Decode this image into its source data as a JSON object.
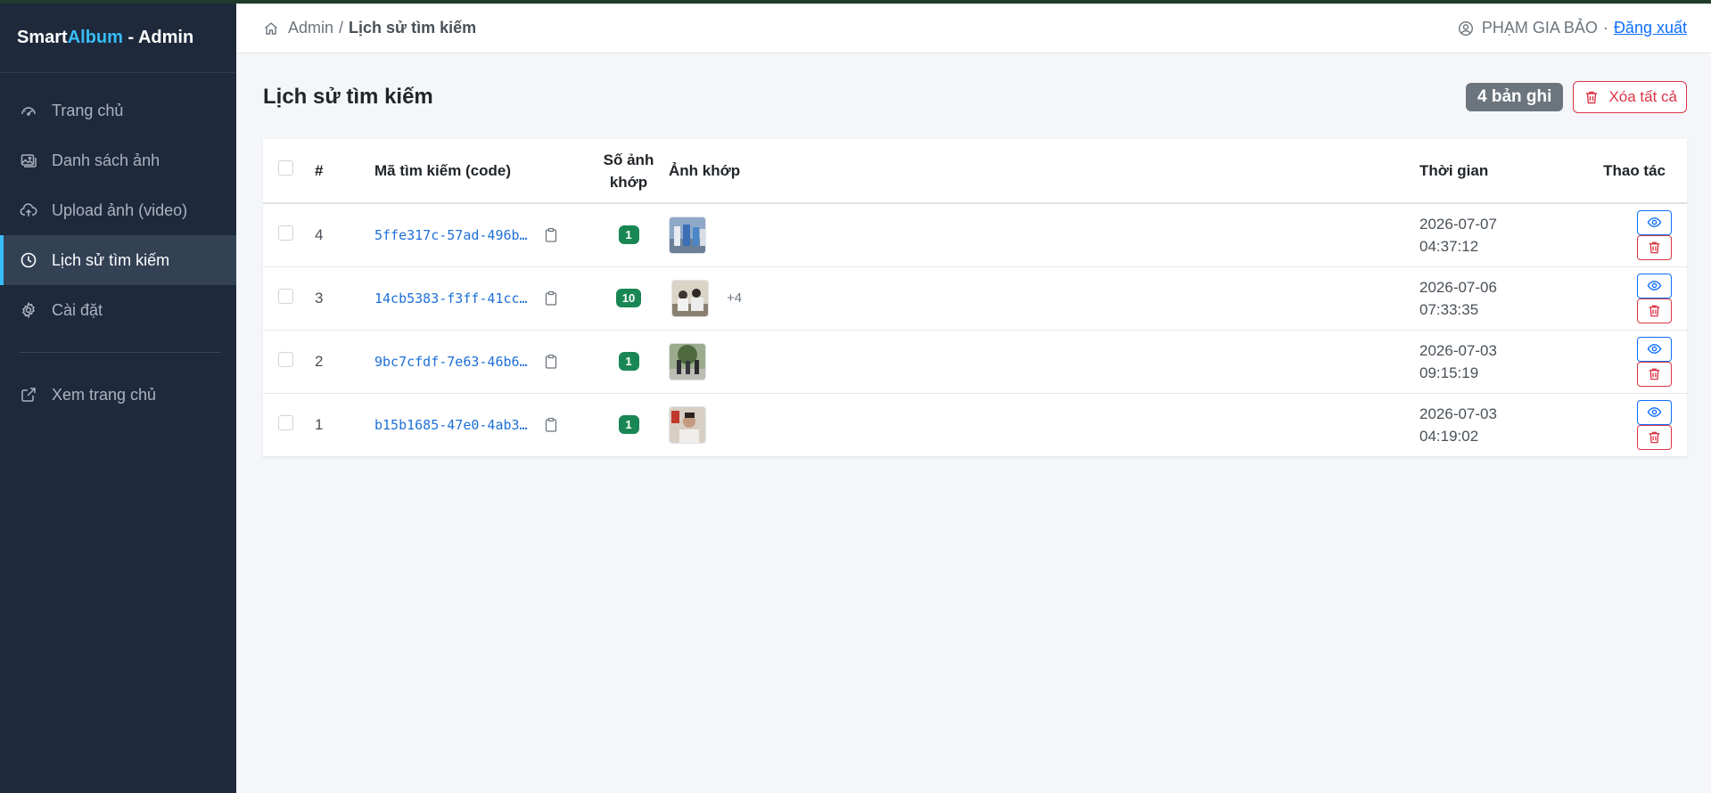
{
  "brand": {
    "part1": "Smart",
    "part2": "Album",
    "part3": " - Admin"
  },
  "colors": {
    "sidebar": "#1e293b",
    "accent": "#38bdf8",
    "primary": "#0d6efd",
    "danger": "#dc3545",
    "success": "#198754"
  },
  "sidebar": {
    "items": [
      {
        "label": "Trang chủ",
        "icon": "dashboard-icon"
      },
      {
        "label": "Danh sách ảnh",
        "icon": "images-icon"
      },
      {
        "label": "Upload ảnh (video)",
        "icon": "cloud-upload-icon"
      },
      {
        "label": "Lịch sử tìm kiếm",
        "icon": "clock-icon",
        "active": true
      },
      {
        "label": "Cài đặt",
        "icon": "gear-icon"
      }
    ],
    "external": {
      "label": "Xem trang chủ",
      "icon": "external-link-icon"
    }
  },
  "breadcrumb": {
    "root": "Admin",
    "sep": "/",
    "current": "Lịch sử tìm kiếm"
  },
  "user": {
    "name": "PHẠM GIA BẢO",
    "dot": "·",
    "logout": "Đăng xuất"
  },
  "page": {
    "title": "Lịch sử tìm kiếm",
    "count_badge": "4 bản ghi",
    "clear_label": "Xóa tất cả"
  },
  "table": {
    "headers": {
      "num": "#",
      "code": "Mã tìm kiếm (code)",
      "count_line1": "Số ảnh",
      "count_line2": "khớp",
      "images": "Ảnh khớp",
      "time": "Thời gian",
      "actions": "Thao tác"
    },
    "rows": [
      {
        "num": "4",
        "code": "5ffe317c-57ad-496b…",
        "count": "1",
        "more": "",
        "date": "2026-07-07",
        "clock": "04:37:12"
      },
      {
        "num": "3",
        "code": "14cb5383-f3ff-41cc…",
        "count": "10",
        "more": "+4",
        "date": "2026-07-06",
        "clock": "07:33:35"
      },
      {
        "num": "2",
        "code": "9bc7cfdf-7e63-46b6…",
        "count": "1",
        "more": "",
        "date": "2026-07-03",
        "clock": "09:15:19"
      },
      {
        "num": "1",
        "code": "b15b1685-47e0-4ab3…",
        "count": "1",
        "more": "",
        "date": "2026-07-03",
        "clock": "04:19:02"
      }
    ]
  }
}
